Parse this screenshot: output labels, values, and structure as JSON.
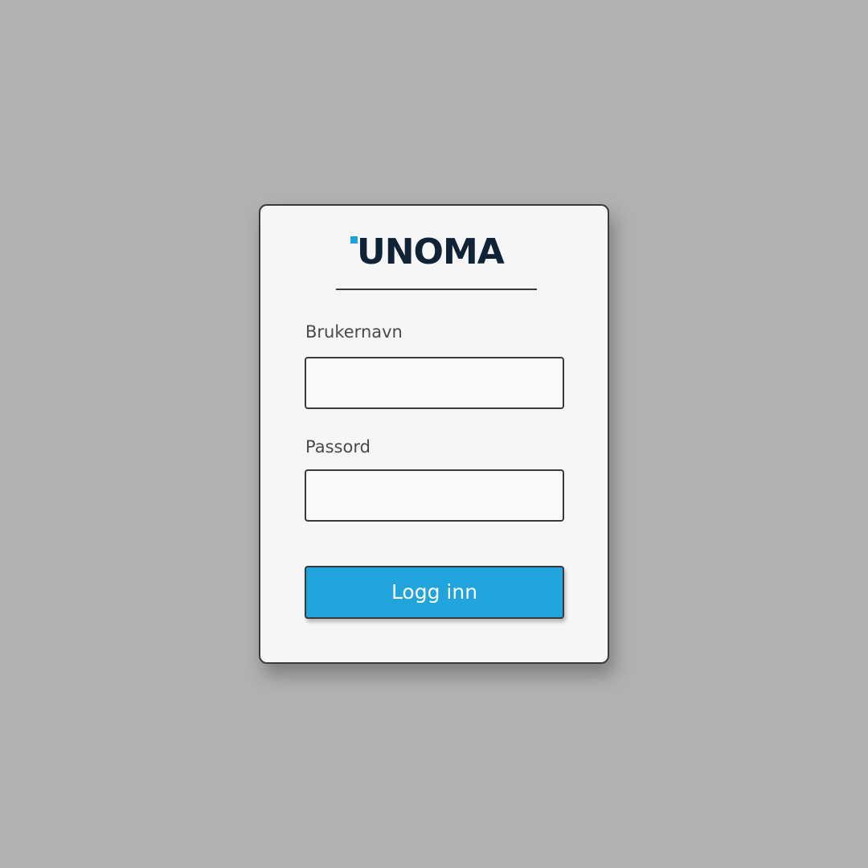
{
  "logo": {
    "text": "UNOMA",
    "text_color": "#0f2236",
    "accent_color": "#1ea2dd"
  },
  "form": {
    "username_label": "Brukernavn",
    "username_value": "",
    "password_label": "Passord",
    "password_value": "",
    "submit_label": "Logg inn"
  },
  "colors": {
    "background": "#b1b1b1",
    "card": "#f6f6f6",
    "button": "#21a3dc",
    "outline": "#3a3a3a"
  }
}
